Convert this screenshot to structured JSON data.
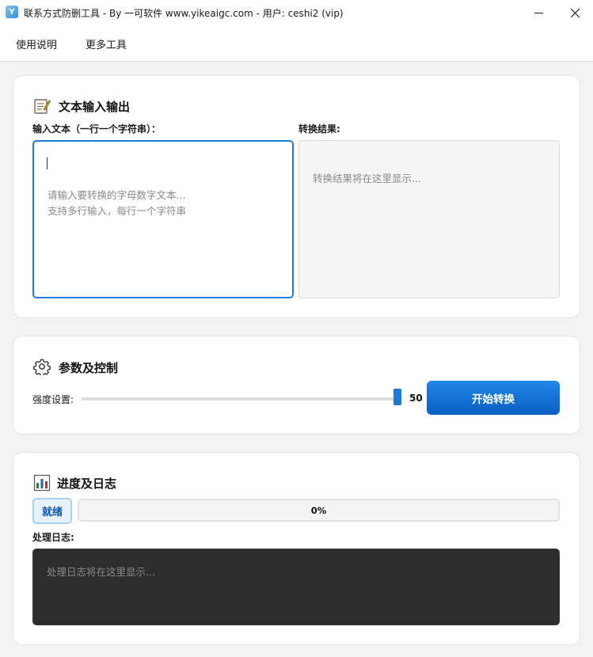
{
  "window": {
    "icon_text": "Y",
    "title": "联系方式防删工具 - By 一可软件 www.yikeaigc.com - 用户: ceshi2 (vip)"
  },
  "menu": {
    "items": [
      "使用说明",
      "更多工具"
    ]
  },
  "io_section": {
    "title": "文本输入输出",
    "icon": "memo-icon",
    "input_label": "输入文本（一行一个字符串）：",
    "input_placeholder": "请输入要转换的字母数字文本...\n支持多行输入，每行一个字符串",
    "input_value": "",
    "output_label": "转换结果:",
    "output_placeholder": "转换结果将在这里显示..."
  },
  "control_section": {
    "title": "参数及控制",
    "icon": "gear-icon",
    "strength_label": "强度设置:",
    "strength_value": 50,
    "strength_fraction": 1.0,
    "start_button": "开始转换"
  },
  "progress_section": {
    "title": "进度及日志",
    "icon": "bar-chart-icon",
    "status": "就绪",
    "progress_percent": 0,
    "progress_text": "0%",
    "log_label": "处理日志:",
    "log_placeholder": "处理日志将在这里显示..."
  },
  "colors": {
    "accent": "#1a7ad4",
    "log_bg": "#2d2d2d"
  }
}
